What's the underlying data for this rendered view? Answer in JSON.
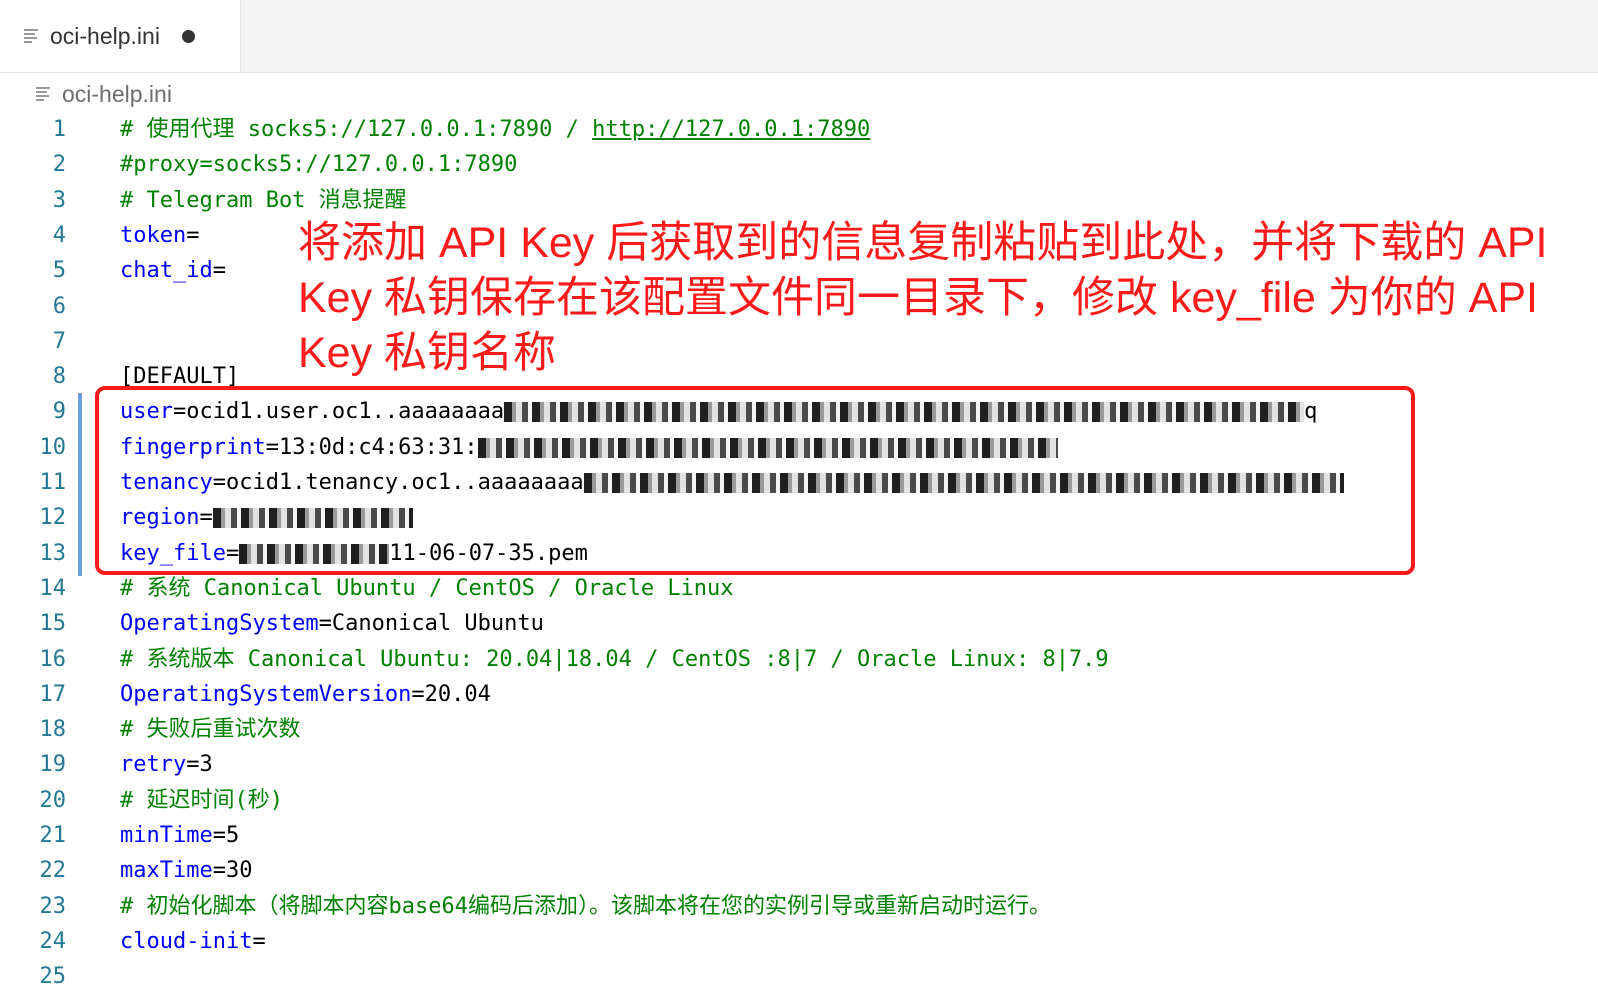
{
  "tab": {
    "label": "oci-help.ini",
    "icon": "file-icon",
    "dirty_icon": "unsaved-dot-icon"
  },
  "breadcrumb": {
    "label": "oci-help.ini",
    "icon": "file-icon"
  },
  "lines": [
    {
      "n": "1",
      "parts": [
        [
          "comment",
          "# 使用代理 socks5://127.0.0.1:7890 / "
        ],
        [
          "link",
          "http://127.0.0.1:7890"
        ]
      ]
    },
    {
      "n": "2",
      "parts": [
        [
          "comment",
          "#proxy=socks5://127.0.0.1:7890"
        ]
      ]
    },
    {
      "n": "3",
      "parts": [
        [
          "comment",
          "# Telegram Bot 消息提醒"
        ]
      ]
    },
    {
      "n": "4",
      "parts": [
        [
          "key",
          "token"
        ],
        [
          "val",
          "="
        ]
      ]
    },
    {
      "n": "5",
      "parts": [
        [
          "key",
          "chat_id"
        ],
        [
          "val",
          "="
        ]
      ]
    },
    {
      "n": "6",
      "parts": []
    },
    {
      "n": "7",
      "parts": []
    },
    {
      "n": "8",
      "parts": [
        [
          "val",
          "[DEFAULT]"
        ]
      ]
    },
    {
      "n": "9",
      "parts": [
        [
          "key",
          "user"
        ],
        [
          "val",
          "=ocid1.user.oc1..aaaaaaaa"
        ],
        [
          "redact",
          "800"
        ],
        [
          "val",
          "q"
        ]
      ]
    },
    {
      "n": "10",
      "parts": [
        [
          "key",
          "fingerprint"
        ],
        [
          "val",
          "=13:0d:c4:63:31:"
        ],
        [
          "redact",
          "580"
        ]
      ]
    },
    {
      "n": "11",
      "parts": [
        [
          "key",
          "tenancy"
        ],
        [
          "val",
          "=ocid1.tenancy.oc1..aaaaaaaa"
        ],
        [
          "redact",
          "760"
        ]
      ]
    },
    {
      "n": "12",
      "parts": [
        [
          "key",
          "region"
        ],
        [
          "val",
          "="
        ],
        [
          "redact",
          "200"
        ]
      ]
    },
    {
      "n": "13",
      "parts": [
        [
          "key",
          "key_file"
        ],
        [
          "val",
          "="
        ],
        [
          "redact",
          "150"
        ],
        [
          "val",
          "11-06-07-35.pem"
        ]
      ]
    },
    {
      "n": "14",
      "parts": [
        [
          "comment",
          "# 系统 Canonical Ubuntu / CentOS / Oracle Linux"
        ]
      ]
    },
    {
      "n": "15",
      "parts": [
        [
          "key",
          "OperatingSystem"
        ],
        [
          "val",
          "=Canonical Ubuntu"
        ]
      ]
    },
    {
      "n": "16",
      "parts": [
        [
          "comment",
          "# 系统版本 Canonical Ubuntu: 20.04|18.04 / CentOS :8|7 / Oracle Linux: 8|7.9"
        ]
      ]
    },
    {
      "n": "17",
      "parts": [
        [
          "key",
          "OperatingSystemVersion"
        ],
        [
          "val",
          "=20.04"
        ]
      ]
    },
    {
      "n": "18",
      "parts": [
        [
          "comment",
          "# 失败后重试次数"
        ]
      ]
    },
    {
      "n": "19",
      "parts": [
        [
          "key",
          "retry"
        ],
        [
          "val",
          "=3"
        ]
      ]
    },
    {
      "n": "20",
      "parts": [
        [
          "comment",
          "# 延迟时间(秒)"
        ]
      ]
    },
    {
      "n": "21",
      "parts": [
        [
          "key",
          "minTime"
        ],
        [
          "val",
          "=5"
        ]
      ]
    },
    {
      "n": "22",
      "parts": [
        [
          "key",
          "maxTime"
        ],
        [
          "val",
          "=30"
        ]
      ]
    },
    {
      "n": "23",
      "parts": [
        [
          "comment",
          "# 初始化脚本（将脚本内容base64编码后添加）。该脚本将在您的实例引导或重新启动时运行。"
        ]
      ]
    },
    {
      "n": "24",
      "parts": [
        [
          "key",
          "cloud-init"
        ],
        [
          "val",
          "="
        ]
      ]
    },
    {
      "n": "25",
      "parts": []
    }
  ],
  "annotation": "将添加 API Key 后获取到的信息复制粘贴到此处，并将下载的 API Key 私钥保存在该配置文件同一目录下，修改 key_file 为你的 API Key 私钥名称",
  "colors": {
    "comment": "#008000",
    "key": "#0000ff",
    "annotation": "#ff1a1a",
    "line_number": "#237893"
  }
}
